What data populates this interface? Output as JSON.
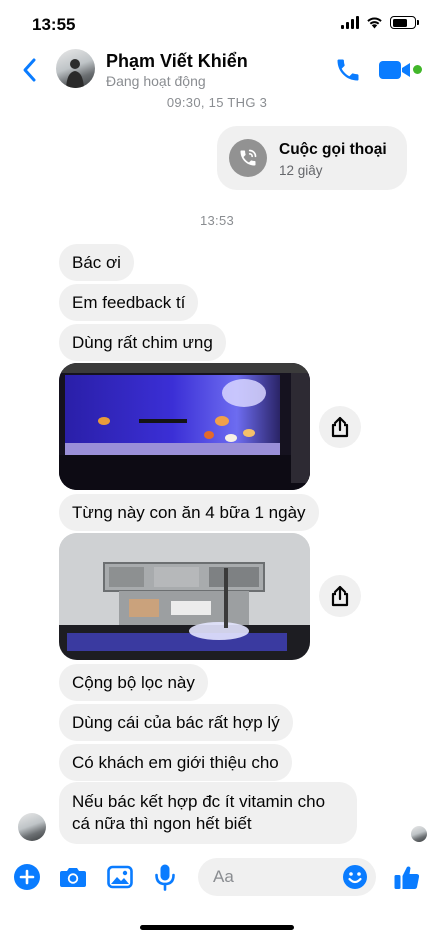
{
  "status_bar": {
    "time": "13:55"
  },
  "header": {
    "contact_name": "Phạm Viết Khiển",
    "contact_status": "Đang hoạt động"
  },
  "thread": {
    "timestamp_1": "09:30, 15 THG 3",
    "call": {
      "title": "Cuộc gọi thoại",
      "duration": "12 giây"
    },
    "timestamp_2": "13:53",
    "messages": [
      "Bác ơi",
      "Em feedback tí",
      "Dùng rất chim ưng",
      "Từng này con ăn 4 bữa 1 ngày",
      "Cộng bộ lọc này",
      "Dùng cái của bác rất hợp lý",
      "Có khách em giới thiệu cho",
      "Nếu bác kết hợp đc ít vitamin cho cá nữa thì ngon hết biết"
    ]
  },
  "composer": {
    "placeholder": "Aa"
  },
  "colors": {
    "accent": "#0a7cff",
    "bubble": "#f0f0f0",
    "online": "#42b72a",
    "meta_text": "#8a8d91"
  },
  "icons": [
    "back-chevron-icon",
    "phone-icon",
    "video-camera-icon",
    "phone-call-icon",
    "share-icon",
    "plus-icon",
    "camera-icon",
    "image-icon",
    "microphone-icon",
    "emoji-icon",
    "thumbs-up-icon"
  ]
}
